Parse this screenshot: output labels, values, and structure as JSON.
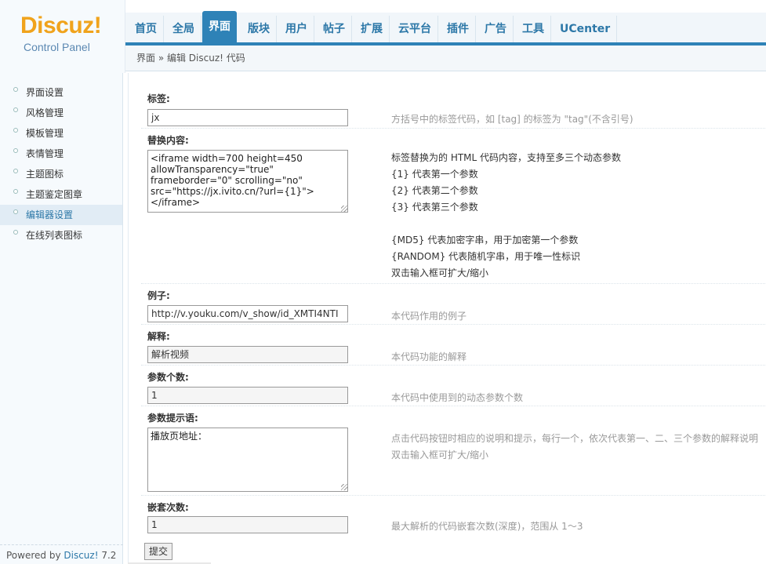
{
  "logo": {
    "brand": "Discuz!",
    "subtitle": "Control Panel"
  },
  "topnav": [
    {
      "label": "首页",
      "active": false
    },
    {
      "label": "全局",
      "active": false
    },
    {
      "label": "界面",
      "active": true
    },
    {
      "label": "版块",
      "active": false
    },
    {
      "label": "用户",
      "active": false
    },
    {
      "label": "帖子",
      "active": false
    },
    {
      "label": "扩展",
      "active": false
    },
    {
      "label": "云平台",
      "active": false
    },
    {
      "label": "插件",
      "active": false
    },
    {
      "label": "广告",
      "active": false
    },
    {
      "label": "工具",
      "active": false
    },
    {
      "label": "UCenter",
      "active": false
    }
  ],
  "breadcrumb": "界面 » 编辑 Discuz! 代码",
  "sidebar": {
    "items": [
      {
        "label": "界面设置",
        "active": false
      },
      {
        "label": "风格管理",
        "active": false
      },
      {
        "label": "模板管理",
        "active": false
      },
      {
        "label": "表情管理",
        "active": false
      },
      {
        "label": "主题图标",
        "active": false
      },
      {
        "label": "主题鉴定图章",
        "active": false
      },
      {
        "label": "编辑器设置",
        "active": true
      },
      {
        "label": "在线列表图标",
        "active": false
      }
    ],
    "powered_prefix": "Powered by ",
    "powered_brand": "Discuz!",
    "powered_version": " 7.2"
  },
  "form": {
    "tag": {
      "label": "标签:",
      "value": "jx",
      "tip": "方括号中的标签代码，如 [tag] 的标签为 \"tag\"(不含引号)"
    },
    "replacement": {
      "label": "替换内容:",
      "value": "<iframe width=700 height=450\nallowTransparency=\"true\"\nframeborder=\"0\" scrolling=\"no\"\nsrc=\"https://jx.ivito.cn/?url={1}\">\n</iframe>",
      "tips": [
        "标签替换为的 HTML 代码内容，支持至多三个动态参数",
        "{1} 代表第一个参数",
        "{2} 代表第二个参数",
        "{3} 代表第三个参数",
        "",
        "{MD5} 代表加密字串，用于加密第一个参数",
        "{RANDOM} 代表随机字串，用于唯一性标识",
        "双击输入框可扩大/缩小"
      ]
    },
    "example": {
      "label": "例子:",
      "value": "http://v.youku.com/v_show/id_XMTI4NTI",
      "tip": "本代码作用的例子"
    },
    "explanation": {
      "label": "解释:",
      "value": "解析视频",
      "tip": "本代码功能的解释"
    },
    "param_count": {
      "label": "参数个数:",
      "value": "1",
      "tip": "本代码中使用到的动态参数个数"
    },
    "param_prompt": {
      "label": "参数提示语:",
      "value": "播放页地址：",
      "tips": [
        "点击代码按钮时相应的说明和提示，每行一个，依次代表第一、二、三个参数的解释说明",
        "双击输入框可扩大/缩小"
      ]
    },
    "nesting": {
      "label": "嵌套次数:",
      "value": "1",
      "tip": "最大解析的代码嵌套次数(深度)，范围从 1～3"
    },
    "submit_label": "提交"
  }
}
